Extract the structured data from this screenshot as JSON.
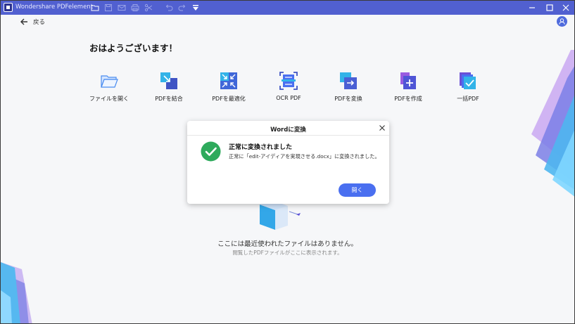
{
  "window": {
    "app_title": "Wondershare PDFelement",
    "toolbar_icons": [
      "folder-icon",
      "save-icon",
      "mail-icon",
      "print-icon",
      "cut-icon",
      "undo-icon",
      "redo-icon",
      "dropdown-icon"
    ],
    "controls": [
      "minimize-icon",
      "maximize-icon",
      "close-icon"
    ]
  },
  "header": {
    "back_label": "戻る"
  },
  "home": {
    "greeting": "おはようございます！",
    "actions": [
      {
        "label": "ファイルを開く",
        "icon": "folder-open-icon"
      },
      {
        "label": "PDFを結合",
        "icon": "combine-icon"
      },
      {
        "label": "PDFを最適化",
        "icon": "compress-icon"
      },
      {
        "label": "OCR PDF",
        "icon": "ocr-icon"
      },
      {
        "label": "PDFを変換",
        "icon": "convert-icon"
      },
      {
        "label": "PDFを作成",
        "icon": "create-icon"
      },
      {
        "label": "一括PDF",
        "icon": "batch-icon"
      }
    ],
    "empty_message": "ここには最近使われたファイルはありません。",
    "empty_sub": "閲覧したPDFファイルがここに表示されます。"
  },
  "dialog": {
    "title": "Wordに変換",
    "heading": "正常に変換されました",
    "body": "正常に「edit-アイディアを実現させる.docx」に変換されました。",
    "open_button": "開く"
  },
  "colors": {
    "titlebar": "#5160d0",
    "accent": "#4a6ff0",
    "success": "#2eaa5c"
  }
}
